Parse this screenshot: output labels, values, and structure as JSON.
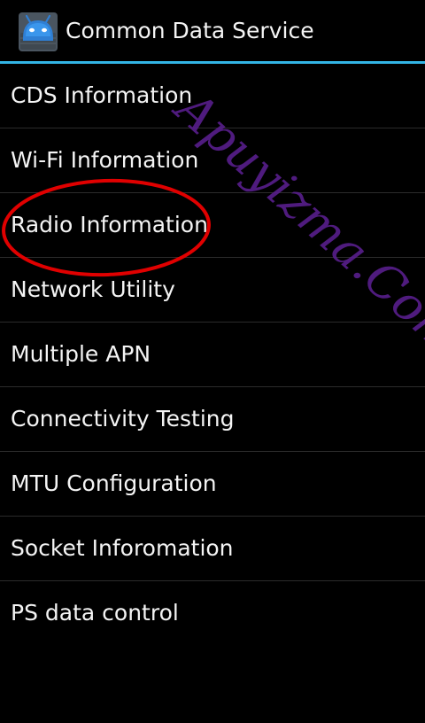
{
  "action_bar": {
    "title": "Common Data Service",
    "icon": "android-robot-icon"
  },
  "accent_color": "#33b5e5",
  "menu": {
    "items": [
      {
        "label": "CDS Information"
      },
      {
        "label": "Wi-Fi Information"
      },
      {
        "label": "Radio Information"
      },
      {
        "label": "Network Utility"
      },
      {
        "label": "Multiple APN"
      },
      {
        "label": "Connectivity Testing"
      },
      {
        "label": "MTU Configuration"
      },
      {
        "label": "Socket Inforomation"
      },
      {
        "label": "PS data control"
      }
    ]
  },
  "annotation": {
    "shape": "ellipse",
    "color": "#e00000",
    "highlights": "Radio Information"
  },
  "watermark": {
    "text": "Apuyizma.Com",
    "color": "#5a1f8f"
  }
}
